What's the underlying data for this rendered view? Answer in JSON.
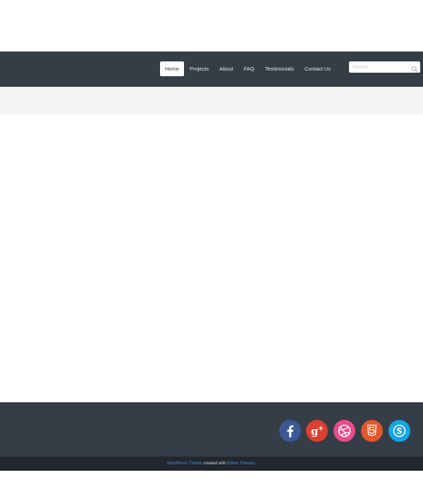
{
  "nav": {
    "items": [
      {
        "label": "Home",
        "active": true
      },
      {
        "label": "Projects",
        "active": false
      },
      {
        "label": "About",
        "active": false
      },
      {
        "label": "FAQ",
        "active": false
      },
      {
        "label": "Testimonials",
        "active": false
      },
      {
        "label": "Contact Us",
        "active": false
      }
    ]
  },
  "search": {
    "placeholder": "Search",
    "value": "",
    "icon": "search-icon"
  },
  "footer": {
    "social": [
      {
        "name": "facebook-icon",
        "color": "#3b5998"
      },
      {
        "name": "google-plus-icon",
        "color": "#d9412e"
      },
      {
        "name": "dribbble-icon",
        "color": "#ea4c89"
      },
      {
        "name": "html5-icon",
        "color": "#e4572e"
      },
      {
        "name": "skype-icon",
        "color": "#12a5e7"
      }
    ],
    "credit": {
      "theme_link": "WordPress Theme",
      "middle": " created with ",
      "author_link": "Billion Themes",
      "end": "."
    }
  }
}
